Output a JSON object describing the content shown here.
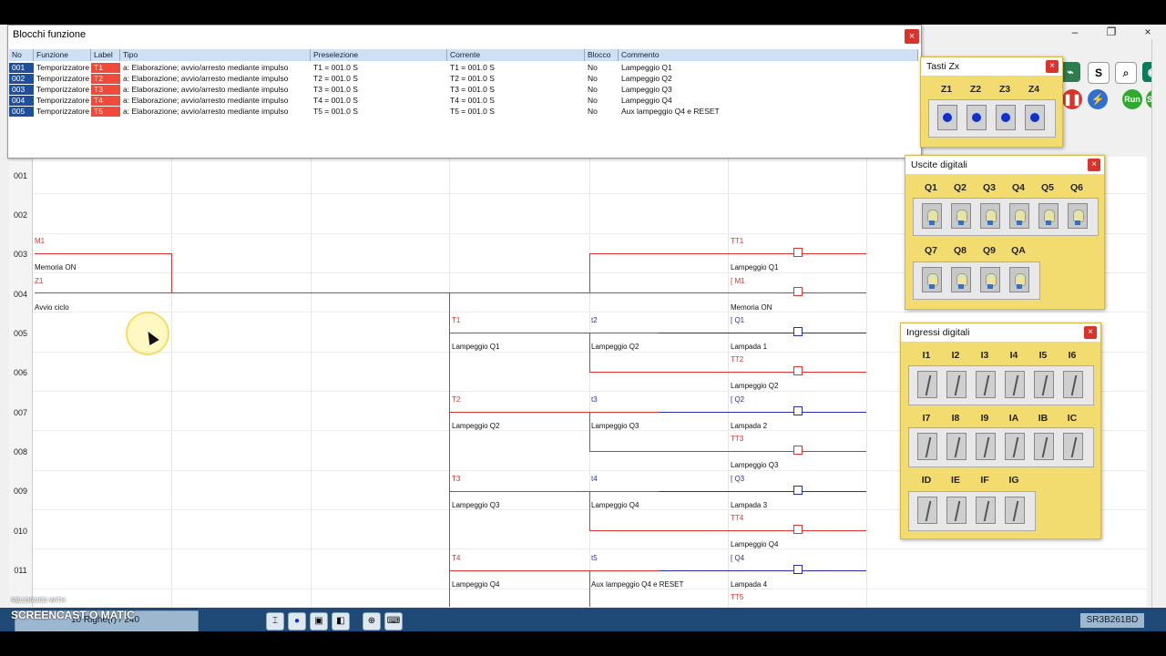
{
  "dialog": {
    "title": "Blocchi funzione",
    "close": "×",
    "columns": [
      "No",
      "Funzione",
      "Label",
      "Tipo",
      "Preselezione",
      "Corrente",
      "Blocco",
      "Commento"
    ],
    "rows": [
      {
        "no": "001",
        "funzione": "Temporizzatore",
        "label": "T1",
        "tipo": "a: Elaborazione; avvio/arresto mediante impulso",
        "preselezione": "T1 = 001.0 S",
        "corrente": "T1 = 001.0 S",
        "blocco": "No",
        "commento": "Lampeggio Q1"
      },
      {
        "no": "002",
        "funzione": "Temporizzatore",
        "label": "T2",
        "tipo": "a: Elaborazione; avvio/arresto mediante impulso",
        "preselezione": "T2 = 001.0 S",
        "corrente": "T2 = 001.0 S",
        "blocco": "No",
        "commento": "Lampeggio Q2"
      },
      {
        "no": "003",
        "funzione": "Temporizzatore",
        "label": "T3",
        "tipo": "a: Elaborazione; avvio/arresto mediante impulso",
        "preselezione": "T3 = 001.0 S",
        "corrente": "T3 = 001.0 S",
        "blocco": "No",
        "commento": "Lampeggio Q3"
      },
      {
        "no": "004",
        "funzione": "Temporizzatore",
        "label": "T4",
        "tipo": "a: Elaborazione; avvio/arresto mediante impulso",
        "preselezione": "T4 = 001.0 S",
        "corrente": "T4 = 001.0 S",
        "blocco": "No",
        "commento": "Lampeggio Q4"
      },
      {
        "no": "005",
        "funzione": "Temporizzatore",
        "label": "T5",
        "tipo": "a: Elaborazione; avvio/arresto mediante impulso",
        "preselezione": "T5 = 001.0 S",
        "corrente": "T5 = 001.0 S",
        "blocco": "No",
        "commento": "Aux lampeggio Q4 e RESET"
      }
    ]
  },
  "ladder": {
    "row_numbers": [
      "001",
      "002",
      "003",
      "004",
      "005",
      "006",
      "007",
      "008",
      "009",
      "010",
      "011"
    ],
    "labels": {
      "m1": "M1",
      "memoria_on_1": "Memoria ON",
      "z1": "Z1",
      "avvio_ciclo": "Avvio ciclo",
      "tt1": "TT1",
      "lampeggio_q1_coil": "Lampeggio Q1",
      "m1_coil": "[ M1",
      "memoria_on_2": "Memoria ON",
      "t1": "T1",
      "lampeggio_q1_a": "Lampeggio Q1",
      "t2_small": "t2",
      "lampeggio_q2_a": "Lampeggio Q2",
      "q1_coil": "[ Q1",
      "lampada_1": "Lampada 1",
      "tt2": "TT2",
      "lampeggio_q2_coil": "Lampeggio Q2",
      "t2": "T2",
      "lampeggio_q2_b": "Lampeggio Q2",
      "t3_small": "t3",
      "lampeggio_q3_a": "Lampeggio Q3",
      "q2_coil": "[ Q2",
      "lampada_2": "Lampada 2",
      "tt3": "TT3",
      "lampeggio_q3_coil": "Lampeggio Q3",
      "t3": "T3",
      "lampeggio_q3_b": "Lampeggio Q3",
      "t4_small": "t4",
      "lampeggio_q4_a": "Lampeggio Q4",
      "q3_coil": "[ Q3",
      "lampada_3": "Lampada 3",
      "tt4": "TT4",
      "lampeggio_q4_coil": "Lampeggio Q4",
      "t4": "T4",
      "lampeggio_q4_b": "Lampeggio Q4",
      "t5_small": "t5",
      "aux_reset": "Aux lampeggio Q4 e RESET",
      "q4_coil": "[ Q4",
      "lampada_4": "Lampada 4",
      "tt5": "TT5"
    }
  },
  "tasti_zx": {
    "title": "Tasti Zx",
    "close": "×",
    "keys": [
      "Z1",
      "Z2",
      "Z3",
      "Z4"
    ]
  },
  "uscite_digitali": {
    "title": "Uscite digitali",
    "close": "×",
    "row1": [
      "Q1",
      "Q2",
      "Q3",
      "Q4",
      "Q5",
      "Q6"
    ],
    "row2": [
      "Q7",
      "Q8",
      "Q9",
      "QA"
    ]
  },
  "ingressi_digitali": {
    "title": "Ingressi digitali",
    "close": "×",
    "row1": [
      "I1",
      "I2",
      "I3",
      "I4",
      "I5",
      "I6"
    ],
    "row2": [
      "I7",
      "I8",
      "I9",
      "IA",
      "IB",
      "IC"
    ],
    "row3": [
      "ID",
      "IE",
      "IF",
      "IG"
    ]
  },
  "toolbar": {
    "run": "Run",
    "stop": "Stop",
    "s_button": "S"
  },
  "window_controls": {
    "minimize": "–",
    "restore": "❐",
    "close": "×"
  },
  "status": {
    "text": "10 Righe(r) / 240",
    "model": "SR3B261BD"
  },
  "watermark": {
    "recorded_with": "RECORDED WITH",
    "brand": "SCREENCAST O MATIC"
  },
  "colors": {
    "accent_red": "#e03030",
    "accent_blue": "#2a2ab0",
    "panel_yellow": "#f3dc6f",
    "taskbar": "#1f4a78"
  }
}
